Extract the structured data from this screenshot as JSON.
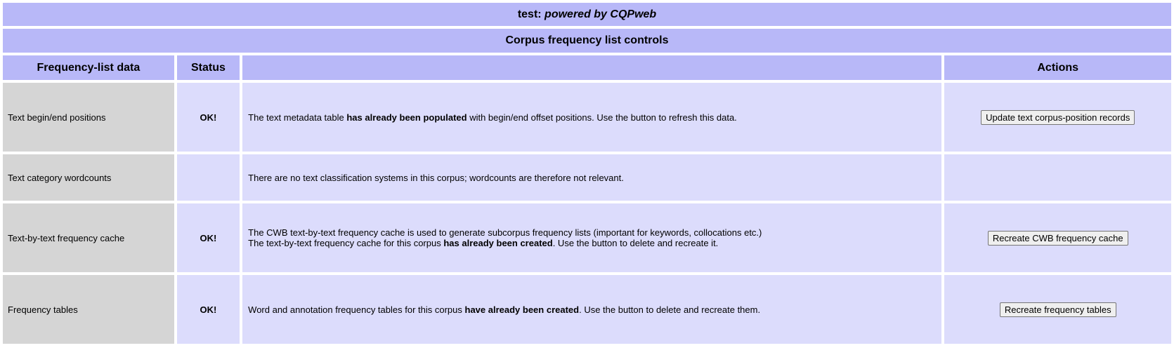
{
  "header": {
    "title_prefix": "test: ",
    "title_em": "powered by CQPweb",
    "section_title": "Corpus frequency list controls"
  },
  "columns": {
    "data": "Frequency-list data",
    "status": "Status",
    "description": "",
    "actions": "Actions"
  },
  "rows": [
    {
      "name": "Text begin/end positions",
      "status": "OK!",
      "desc": {
        "before": "The text metadata table ",
        "bold": "has already been populated",
        "after": " with begin/end offset positions. Use the button to refresh this data."
      },
      "button": "Update text corpus-position records"
    },
    {
      "name": "Text category wordcounts",
      "status": "",
      "desc": {
        "text": "There are no text classification systems in this corpus; wordcounts are therefore not relevant."
      },
      "button": ""
    },
    {
      "name": "Text-by-text frequency cache",
      "status": "OK!",
      "desc": {
        "line1": "The CWB text-by-text frequency cache is used to generate subcorpus frequency lists (important for keywords, collocations etc.)",
        "before": "The text-by-text frequency cache for this corpus ",
        "bold": "has already been created",
        "after": ". Use the button to delete and recreate it."
      },
      "button": "Recreate CWB frequency cache"
    },
    {
      "name": "Frequency tables",
      "status": "OK!",
      "desc": {
        "before": "Word and annotation frequency tables for this corpus ",
        "bold": "have already been created",
        "after": ". Use the button to delete and recreate them."
      },
      "button": "Recreate frequency tables"
    }
  ],
  "colors": {
    "header_bg": "#b8b8f8",
    "general_bg": "#dcdcfc",
    "grey_bg": "#d5d5d5"
  }
}
